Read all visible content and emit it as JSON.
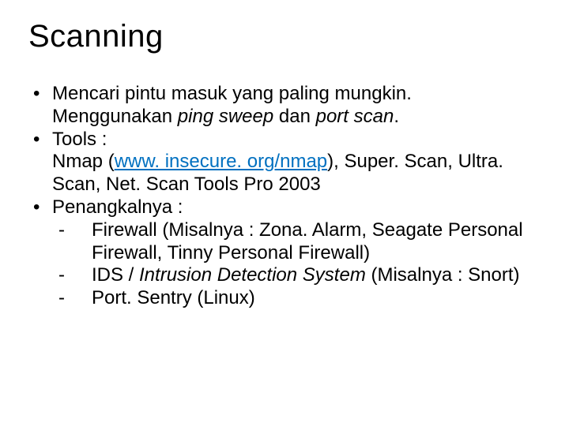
{
  "title": "Scanning",
  "bullets": {
    "b1_line1": "Mencari pintu masuk yang paling mungkin.",
    "b1_line2_pre": "Menggunakan ",
    "b1_line2_em1": "ping sweep",
    "b1_line2_mid": " dan ",
    "b1_line2_em2": "port scan",
    "b1_line2_post": ".",
    "b2_line1": "Tools :",
    "b2_line2_pre": "Nmap (",
    "b2_line2_link": "www. insecure. org/nmap",
    "b2_line2_post": "), Super. Scan, Ultra. Scan, Net. Scan Tools Pro 2003",
    "b3_line1": "Penangkalnya :",
    "sub1": "Firewall (Misalnya : Zona. Alarm,    Seagate Personal Firewall, Tinny Personal Firewall)",
    "sub2_pre": "IDS / ",
    "sub2_em": "Intrusion Detection System",
    "sub2_post": "   (Misalnya : Snort)",
    "sub3": "Port. Sentry (Linux)"
  },
  "dash": "-",
  "link_href": "#"
}
